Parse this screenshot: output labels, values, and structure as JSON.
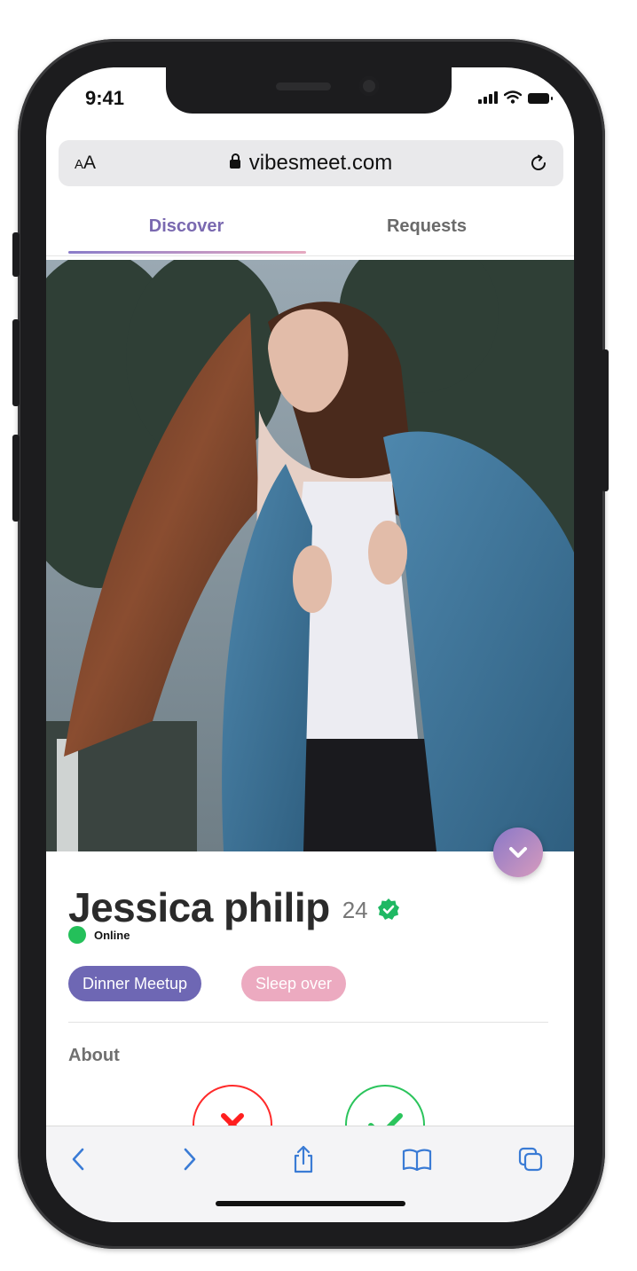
{
  "status_bar": {
    "time": "9:41"
  },
  "browser": {
    "text_size_small": "A",
    "text_size_large": "A",
    "url": "vibesmeet.com"
  },
  "tabs": [
    {
      "label": "Discover",
      "active": true
    },
    {
      "label": "Requests",
      "active": false
    }
  ],
  "profile": {
    "name": "Jessica philip",
    "age": "24",
    "verified": true,
    "status": "Online",
    "tags": [
      "Dinner Meetup",
      "Sleep over"
    ],
    "about_heading": "About"
  },
  "photo": {
    "description_icon": "profile-photo"
  },
  "colors": {
    "accent_purple": "#7a69b0",
    "accent_pink": "#ecaac0",
    "online_green": "#24c05a",
    "reject_red": "#ff2a2a",
    "accept_green": "#2bc45c",
    "verified_green": "#1fb863"
  },
  "bottom_toolbar": [
    "back-icon",
    "forward-icon",
    "share-icon",
    "bookmarks-icon",
    "tabs-icon"
  ]
}
